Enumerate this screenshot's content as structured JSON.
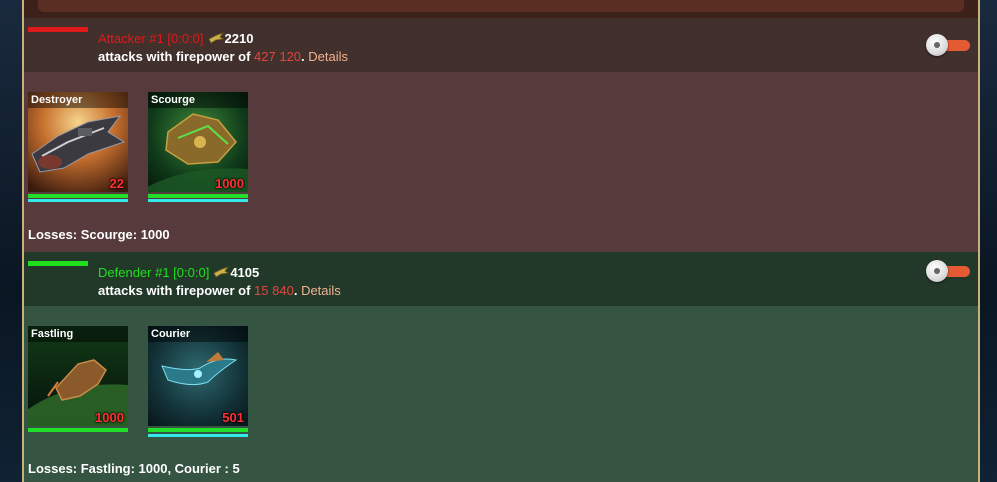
{
  "colors": {
    "attacker_accent": "#e0191b",
    "defender_accent": "#1fe11b",
    "firepower": "#e0463f",
    "details_link": "#f2b391",
    "ship_count": "#ff3030",
    "hp_bar": "#22e02a",
    "shield_bar": "#33e8e8",
    "toggle": "#e45a32"
  },
  "attacker": {
    "title": "Attacker #1 [0:0:0]",
    "score_icon": "ship-icon",
    "score": "2210",
    "firepower_prefix": "attacks with firepower of",
    "firepower": "427 120",
    "period": ".",
    "details_label": "Details",
    "toggle_icon": "toggle-switch",
    "ships": [
      {
        "name": "Destroyer",
        "count": "22",
        "hp_fraction": 1.0,
        "shield_fraction": 1.0
      },
      {
        "name": "Scourge",
        "count": "1000",
        "hp_fraction": 1.0,
        "shield_fraction": 1.0
      }
    ],
    "losses": "Losses: Scourge: 1000"
  },
  "defender": {
    "title": "Defender #1 [0:0:0]",
    "score_icon": "ship-icon",
    "score": "4105",
    "firepower_prefix": "attacks with firepower of",
    "firepower": "15 840",
    "period": ".",
    "details_label": "Details",
    "toggle_icon": "toggle-switch",
    "ships": [
      {
        "name": "Fastling",
        "count": "1000",
        "hp_fraction": 1.0,
        "shield_fraction": 0.0
      },
      {
        "name": "Courier",
        "count": "501",
        "hp_fraction": 1.0,
        "shield_fraction": 1.0
      }
    ],
    "losses": "Losses: Fastling: 1000, Courier : 5"
  }
}
